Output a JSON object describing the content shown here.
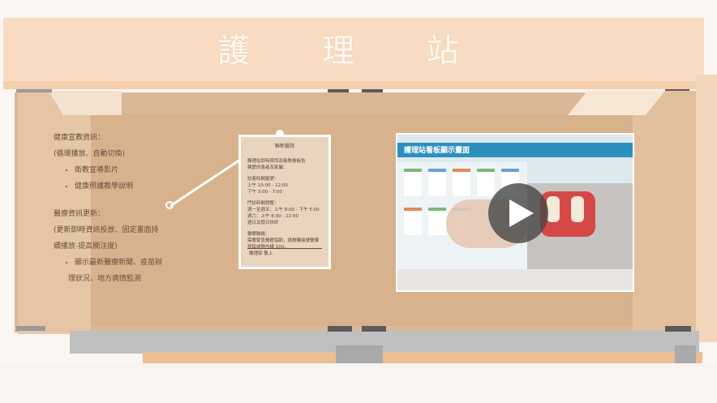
{
  "sign": {
    "title": "護 理 站"
  },
  "info_panel": {
    "block1_title": "健康宣教資訊：",
    "block1_sub": "(循環播放、自動切換)",
    "block1_items": [
      "衛教宣導影片",
      "健康照護教學說明"
    ],
    "block2_title": "醫療資訊更新：",
    "block2_sub1": "(更新即時資訊投放、固定畫面持",
    "block2_sub2": "續播放-提高關注度)",
    "block2_item_line1": "顯示最新醫療新聞、疫苗辦",
    "block2_item_line2": "理狀況、地方病情監測"
  },
  "notice_card": {
    "title": "聯新醫院",
    "intro": "護理站即時資訊及衛教看板告\n親愛的患者及家屬：",
    "visit_title": "訪客時間變更：",
    "visit_am": "上午 10:00 - 12:00",
    "visit_pm": "下午 3:00 - 7:00",
    "clinic_title": "門診時間調整：",
    "clinic_weekday": "週一至週五：上午 8:00 - 下午 5:00",
    "clinic_sat": "週六：上午 8:00 - 12:00",
    "clinic_sun": "週日及假日休診",
    "reminder_title": "醫療聯絡：",
    "reminder_text": "需要緊急醫療協助，請撥轉接號醫護\n按鈕或撥內線 100。",
    "footer": "護理部 敬上"
  },
  "video": {
    "header": "護理站看板顯示畫面",
    "play_icon": "play-icon"
  },
  "colors": {
    "sign": "#f9dcc2",
    "wall": "#dbb895",
    "accent_blue": "#2d8fbf"
  }
}
